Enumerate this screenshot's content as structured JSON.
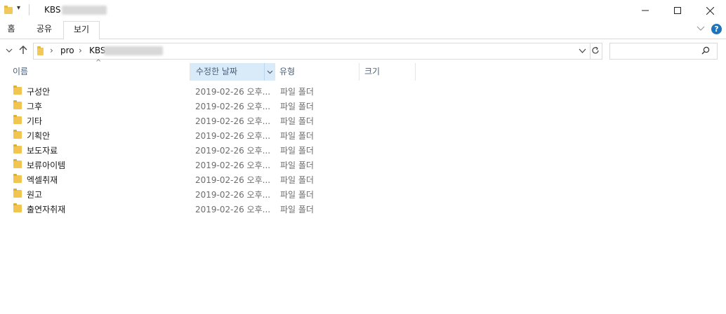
{
  "window": {
    "title": "KBS ",
    "minimize_icon": "minimize-icon",
    "maximize_icon": "maximize-icon",
    "close_icon": "close-icon"
  },
  "ribbon": {
    "tabs": [
      "홈",
      "공유",
      "보기"
    ],
    "active_tab": "보기",
    "expand_icon": "chevron-down-icon",
    "help_icon": "help-icon"
  },
  "address": {
    "path": [
      "pro",
      "KBS"
    ],
    "search_placeholder": ""
  },
  "columns": {
    "name": "이름",
    "date": "수정한 날짜",
    "type": "유형",
    "size": "크기",
    "sort_indicator": "^"
  },
  "items": [
    {
      "name": "구성안",
      "date": "2019-02-26 오후...",
      "type": "파일 폴더"
    },
    {
      "name": "그후",
      "date": "2019-02-26 오후...",
      "type": "파일 폴더"
    },
    {
      "name": "기타",
      "date": "2019-02-26 오후...",
      "type": "파일 폴더"
    },
    {
      "name": "기획안",
      "date": "2019-02-26 오후...",
      "type": "파일 폴더"
    },
    {
      "name": "보도자료",
      "date": "2019-02-26 오후...",
      "type": "파일 폴더"
    },
    {
      "name": "보류아이템",
      "date": "2019-02-26 오후...",
      "type": "파일 폴더"
    },
    {
      "name": "엑셀취재",
      "date": "2019-02-26 오후...",
      "type": "파일 폴더"
    },
    {
      "name": "원고",
      "date": "2019-02-26 오후...",
      "type": "파일 폴더"
    },
    {
      "name": "출연자취재",
      "date": "2019-02-26 오후...",
      "type": "파일 폴더"
    }
  ],
  "colors": {
    "accent": "#1e73be",
    "selected_header": "#d9ebf9",
    "folder": "#f1c550"
  }
}
